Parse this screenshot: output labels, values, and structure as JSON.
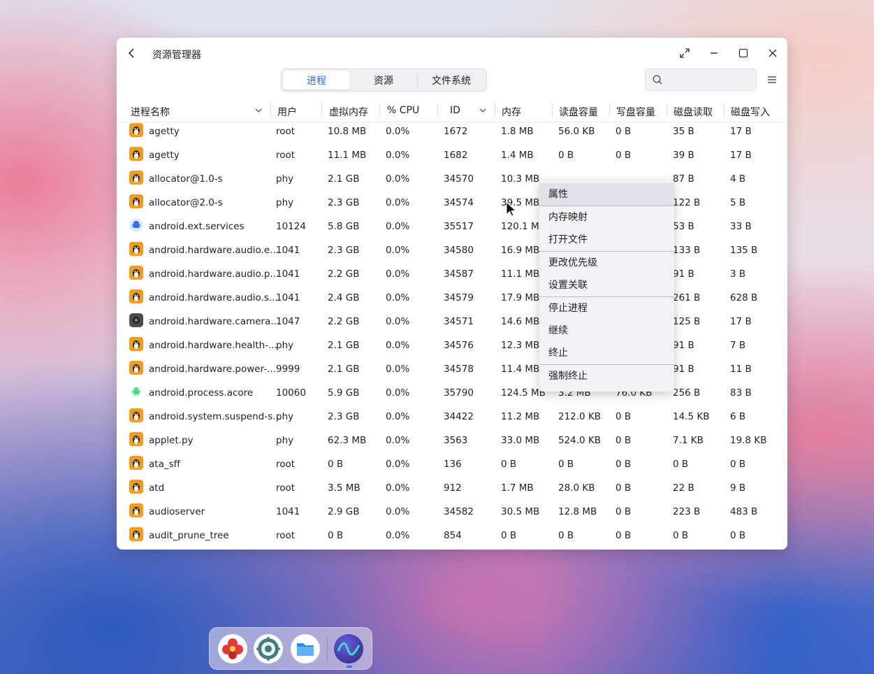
{
  "window": {
    "title": "资源管理器"
  },
  "tabs": [
    {
      "label": "进程",
      "active": true
    },
    {
      "label": "资源",
      "active": false
    },
    {
      "label": "文件系统",
      "active": false
    }
  ],
  "search": {
    "placeholder": "",
    "value": ""
  },
  "columns": [
    "进程名称",
    "用户",
    "虚拟内存",
    "% CPU",
    "ID",
    "内存",
    "读盘容量",
    "写盘容量",
    "磁盘读取",
    "磁盘写入"
  ],
  "rows": [
    {
      "icon": "tux",
      "name": "agetty",
      "user": "root",
      "vmem": "10.8 MB",
      "cpu": "0.0%",
      "id": "1672",
      "mem": "1.8 MB",
      "read": "56.0 KB",
      "write": "0 B",
      "dread": "35 B",
      "dwrite": "17 B"
    },
    {
      "icon": "tux",
      "name": "agetty",
      "user": "root",
      "vmem": "11.1 MB",
      "cpu": "0.0%",
      "id": "1682",
      "mem": "1.4 MB",
      "read": "0 B",
      "write": "0 B",
      "dread": "39 B",
      "dwrite": "17 B"
    },
    {
      "icon": "tux",
      "name": "allocator@1.0-s",
      "user": "phy",
      "vmem": "2.1 GB",
      "cpu": "0.0%",
      "id": "34570",
      "mem": "10.3 MB",
      "read": "",
      "write": "",
      "dread": "87 B",
      "dwrite": "4 B"
    },
    {
      "icon": "tux",
      "name": "allocator@2.0-s",
      "user": "phy",
      "vmem": "2.3 GB",
      "cpu": "0.0%",
      "id": "34574",
      "mem": "39.5 MB",
      "read": "",
      "write": "",
      "dread": "122 B",
      "dwrite": "5 B"
    },
    {
      "icon": "android",
      "name": "android.ext.services",
      "user": "10124",
      "vmem": "5.8 GB",
      "cpu": "0.0%",
      "id": "35517",
      "mem": "120.1 MB",
      "read": "",
      "write": "",
      "dread": "53 B",
      "dwrite": "33 B"
    },
    {
      "icon": "tux",
      "name": "android.hardware.audio.e...",
      "user": "1041",
      "vmem": "2.3 GB",
      "cpu": "0.0%",
      "id": "34580",
      "mem": "16.9 MB",
      "read": "",
      "write": "",
      "dread": "133 B",
      "dwrite": "135 B"
    },
    {
      "icon": "tux",
      "name": "android.hardware.audio.p...",
      "user": "1041",
      "vmem": "2.2 GB",
      "cpu": "0.0%",
      "id": "34587",
      "mem": "11.1 MB",
      "read": "",
      "write": "",
      "dread": "91 B",
      "dwrite": "3 B"
    },
    {
      "icon": "tux",
      "name": "android.hardware.audio.s...",
      "user": "1041",
      "vmem": "2.4 GB",
      "cpu": "0.0%",
      "id": "34579",
      "mem": "17.9 MB",
      "read": "",
      "write": "",
      "dread": "261 B",
      "dwrite": "628 B"
    },
    {
      "icon": "camera",
      "name": "android.hardware.camera...",
      "user": "1047",
      "vmem": "2.2 GB",
      "cpu": "0.0%",
      "id": "34571",
      "mem": "14.6 MB",
      "read": "",
      "write": "",
      "dread": "125 B",
      "dwrite": "17 B"
    },
    {
      "icon": "tux",
      "name": "android.hardware.health-...",
      "user": "phy",
      "vmem": "2.1 GB",
      "cpu": "0.0%",
      "id": "34576",
      "mem": "12.3 MB",
      "read": "",
      "write": "",
      "dread": "91 B",
      "dwrite": "7 B"
    },
    {
      "icon": "tux",
      "name": "android.hardware.power-...",
      "user": "9999",
      "vmem": "2.1 GB",
      "cpu": "0.0%",
      "id": "34578",
      "mem": "11.4 MB",
      "read": "",
      "write": "",
      "dread": "91 B",
      "dwrite": "11 B"
    },
    {
      "icon": "droid",
      "name": "android.process.acore",
      "user": "10060",
      "vmem": "5.9 GB",
      "cpu": "0.0%",
      "id": "35790",
      "mem": "124.5 MB",
      "read": "3.2 MB",
      "write": "76.0 KB",
      "dread": "256 B",
      "dwrite": "83 B"
    },
    {
      "icon": "tux",
      "name": "android.system.suspend-s...",
      "user": "phy",
      "vmem": "2.3 GB",
      "cpu": "0.0%",
      "id": "34422",
      "mem": "11.2 MB",
      "read": "212.0 KB",
      "write": "0 B",
      "dread": "14.5 KB",
      "dwrite": "6 B"
    },
    {
      "icon": "tux",
      "name": "applet.py",
      "user": "phy",
      "vmem": "62.3 MB",
      "cpu": "0.0%",
      "id": "3563",
      "mem": "33.0 MB",
      "read": "524.0 KB",
      "write": "0 B",
      "dread": "7.1 KB",
      "dwrite": "19.8 KB"
    },
    {
      "icon": "tux",
      "name": "ata_sff",
      "user": "root",
      "vmem": "0 B",
      "cpu": "0.0%",
      "id": "136",
      "mem": "0 B",
      "read": "0 B",
      "write": "0 B",
      "dread": "0 B",
      "dwrite": "0 B"
    },
    {
      "icon": "tux",
      "name": "atd",
      "user": "root",
      "vmem": "3.5 MB",
      "cpu": "0.0%",
      "id": "912",
      "mem": "1.7 MB",
      "read": "28.0 KB",
      "write": "0 B",
      "dread": "22 B",
      "dwrite": "9 B"
    },
    {
      "icon": "tux",
      "name": "audioserver",
      "user": "1041",
      "vmem": "2.9 GB",
      "cpu": "0.0%",
      "id": "34582",
      "mem": "30.5 MB",
      "read": "12.8 MB",
      "write": "0 B",
      "dread": "223 B",
      "dwrite": "483 B"
    },
    {
      "icon": "tux",
      "name": "audit_prune_tree",
      "user": "root",
      "vmem": "0 B",
      "cpu": "0.0%",
      "id": "854",
      "mem": "0 B",
      "read": "0 B",
      "write": "0 B",
      "dread": "0 B",
      "dwrite": "0 B"
    }
  ],
  "context_menu": {
    "items": [
      "属性",
      "内存映射",
      "打开文件",
      "更改优先级",
      "设置关联",
      "停止进程",
      "继续",
      "终止",
      "强制终止"
    ],
    "highlighted": "属性"
  },
  "dock": {
    "apps": [
      "flower-icon",
      "settings-icon",
      "files-icon",
      "system-monitor-icon"
    ],
    "active": "system-monitor-icon"
  },
  "colors": {
    "accent": "#2f6de0",
    "tux_bg": "#f29c1f"
  }
}
